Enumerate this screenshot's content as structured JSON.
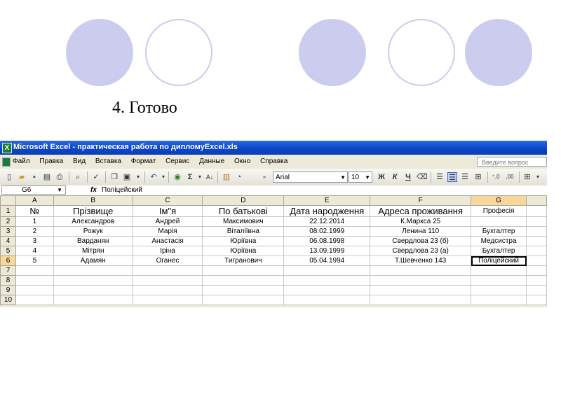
{
  "slide": {
    "title": "4. Готово"
  },
  "window": {
    "title": "Microsoft Excel - практическая работа по дипломуExcel.xls"
  },
  "menu": {
    "items": [
      "Файл",
      "Правка",
      "Вид",
      "Вставка",
      "Формат",
      "Сервис",
      "Данные",
      "Окно",
      "Справка"
    ],
    "help_placeholder": "Введите вопрос"
  },
  "toolbar": {
    "font_name": "Arial",
    "font_size": "10",
    "bold_label": "Ж",
    "italic_label": "К",
    "underline_label": "Ч"
  },
  "formula_bar": {
    "name_box": "G6",
    "fx": "fx",
    "content": "Поліцейский"
  },
  "sheet": {
    "columns": [
      "A",
      "B",
      "C",
      "D",
      "E",
      "F",
      "G"
    ],
    "active_column": "G",
    "active_row": 6,
    "rows": [
      {
        "num": "1",
        "cells": [
          "№",
          "Прізвище",
          "Ім\"я",
          "По батькові",
          "Дата народження",
          "Адреса проживання",
          "Професія"
        ]
      },
      {
        "num": "2",
        "cells": [
          "1",
          "Александров",
          "Андрей",
          "Максимович",
          "22.12.2014",
          "К.Маркса 25",
          ""
        ]
      },
      {
        "num": "3",
        "cells": [
          "2",
          "Рожук",
          "Марія",
          "Віталіївна",
          "08.02.1999",
          "Ленина 110",
          "Бухгалтер"
        ]
      },
      {
        "num": "4",
        "cells": [
          "3",
          "Варданян",
          "Анастасія",
          "Юріївна",
          "06.08.1998",
          "Свердлова 23 (б)",
          "Медсистра"
        ]
      },
      {
        "num": "5",
        "cells": [
          "4",
          "Мітрян",
          "Іріна",
          "Юріївна",
          "13.09.1999",
          "Свердлова 23 (а)",
          "Бухгалтер"
        ]
      },
      {
        "num": "6",
        "cells": [
          "5",
          "Адамян",
          "Оганес",
          "Тигранович",
          "05.04.1994",
          "Т.Шевченко 143",
          "Поліцейский"
        ]
      },
      {
        "num": "7",
        "cells": [
          "",
          "",
          "",
          "",
          "",
          "",
          ""
        ]
      },
      {
        "num": "8",
        "cells": [
          "",
          "",
          "",
          "",
          "",
          "",
          ""
        ]
      },
      {
        "num": "9",
        "cells": [
          "",
          "",
          "",
          "",
          "",
          "",
          ""
        ]
      },
      {
        "num": "10",
        "cells": [
          "",
          "",
          "",
          "",
          "",
          "",
          ""
        ]
      }
    ]
  },
  "colors": {
    "titlebar": "#0b46c8",
    "circle": "#ccccee",
    "active_header": "#f8d89a"
  }
}
